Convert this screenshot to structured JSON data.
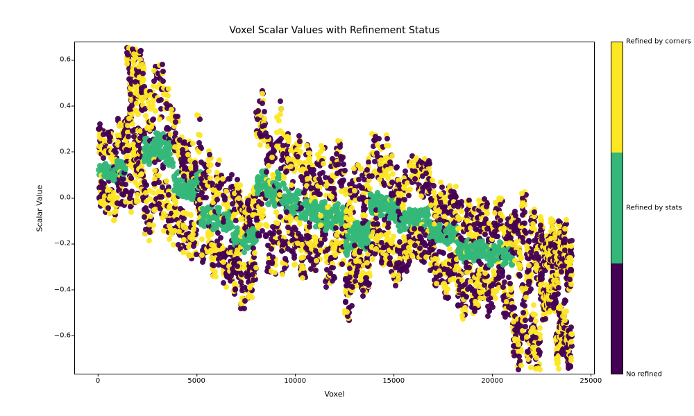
{
  "chart_data": {
    "type": "scatter",
    "title": "Voxel Scalar Values with Refinement Status",
    "xlabel": "Voxel",
    "ylabel": "Scalar Value",
    "xlim": [
      -1200,
      25200
    ],
    "ylim": [
      -0.77,
      0.68
    ],
    "xticks": [
      0,
      5000,
      10000,
      15000,
      20000,
      25000
    ],
    "yticks": [
      -0.6,
      -0.4,
      -0.2,
      0.0,
      0.2,
      0.4,
      0.6
    ],
    "ytick_labels": [
      "−0.6",
      "−0.4",
      "−0.2",
      "0.0",
      "0.2",
      "0.4",
      "0.6"
    ],
    "categories": {
      "0": {
        "name": "No refined",
        "color": "#440154"
      },
      "1": {
        "name": "Refined by stats",
        "color": "#35b779"
      },
      "2": {
        "name": "Refined by corners",
        "color": "#fde725"
      }
    },
    "colorbar": {
      "segments": [
        {
          "color": "#440154",
          "frac": 0.3333
        },
        {
          "color": "#35b779",
          "frac": 0.3333
        },
        {
          "color": "#fde725",
          "frac": 0.3334
        }
      ],
      "tick_positions": [
        0.0,
        0.5,
        1.0
      ],
      "tick_labels": [
        "No refined",
        "Refined by stats",
        "Refined by corners"
      ]
    },
    "note": "Dense scatter (~24000 voxels). Scalar value trends downward with voxel index, clustered in vertical bands ~1500-wide. Category 1 (teal) concentrated near scalar≈0 band; categories 0 (purple) and 2 (yellow) span full vertical extent of each cluster, heavily interleaved.",
    "cluster_summary": [
      {
        "x_start": 0,
        "x_end": 1400,
        "y_low": -0.06,
        "y_high": 0.3,
        "dominant": [
          0,
          1,
          2
        ]
      },
      {
        "x_start": 1400,
        "x_end": 2300,
        "y_low": 0.05,
        "y_high": 0.64,
        "dominant": [
          0,
          2
        ]
      },
      {
        "x_start": 2300,
        "x_end": 3800,
        "y_low": -0.1,
        "y_high": 0.55,
        "dominant": [
          0,
          1,
          2
        ]
      },
      {
        "x_start": 3800,
        "x_end": 5200,
        "y_low": -0.19,
        "y_high": 0.3,
        "dominant": [
          0,
          1,
          2
        ]
      },
      {
        "x_start": 5200,
        "x_end": 6800,
        "y_low": -0.31,
        "y_high": 0.14,
        "dominant": [
          0,
          1,
          2
        ]
      },
      {
        "x_start": 6800,
        "x_end": 8000,
        "y_low": -0.4,
        "y_high": 0.05,
        "dominant": [
          0,
          1,
          2
        ]
      },
      {
        "x_start": 8000,
        "x_end": 9500,
        "y_low": -0.26,
        "y_high": 0.35,
        "dominant": [
          0,
          1,
          2
        ]
      },
      {
        "x_start": 9500,
        "x_end": 11000,
        "y_low": -0.29,
        "y_high": 0.22,
        "dominant": [
          0,
          1,
          2
        ]
      },
      {
        "x_start": 11000,
        "x_end": 12500,
        "y_low": -0.34,
        "y_high": 0.17,
        "dominant": [
          0,
          1,
          2
        ]
      },
      {
        "x_start": 12500,
        "x_end": 13800,
        "y_low": -0.45,
        "y_high": 0.1,
        "dominant": [
          0,
          1,
          2
        ]
      },
      {
        "x_start": 13800,
        "x_end": 15200,
        "y_low": -0.3,
        "y_high": 0.23,
        "dominant": [
          0,
          1,
          2
        ]
      },
      {
        "x_start": 15200,
        "x_end": 16800,
        "y_low": -0.32,
        "y_high": 0.12,
        "dominant": [
          0,
          1,
          2
        ]
      },
      {
        "x_start": 16800,
        "x_end": 18200,
        "y_low": -0.36,
        "y_high": 0.06,
        "dominant": [
          0,
          1,
          2
        ]
      },
      {
        "x_start": 18200,
        "x_end": 19500,
        "y_low": -0.44,
        "y_high": 0.0,
        "dominant": [
          0,
          1,
          2
        ]
      },
      {
        "x_start": 19500,
        "x_end": 21000,
        "y_low": -0.45,
        "y_high": -0.03,
        "dominant": [
          0,
          1,
          2
        ]
      },
      {
        "x_start": 21000,
        "x_end": 22400,
        "y_low": -0.7,
        "y_high": -0.06,
        "dominant": [
          0,
          2
        ]
      },
      {
        "x_start": 22400,
        "x_end": 23200,
        "y_low": -0.47,
        "y_high": -0.14,
        "dominant": [
          0,
          2
        ]
      },
      {
        "x_start": 23200,
        "x_end": 24000,
        "y_low": -0.72,
        "y_high": -0.18,
        "dominant": [
          0,
          2
        ]
      }
    ]
  }
}
